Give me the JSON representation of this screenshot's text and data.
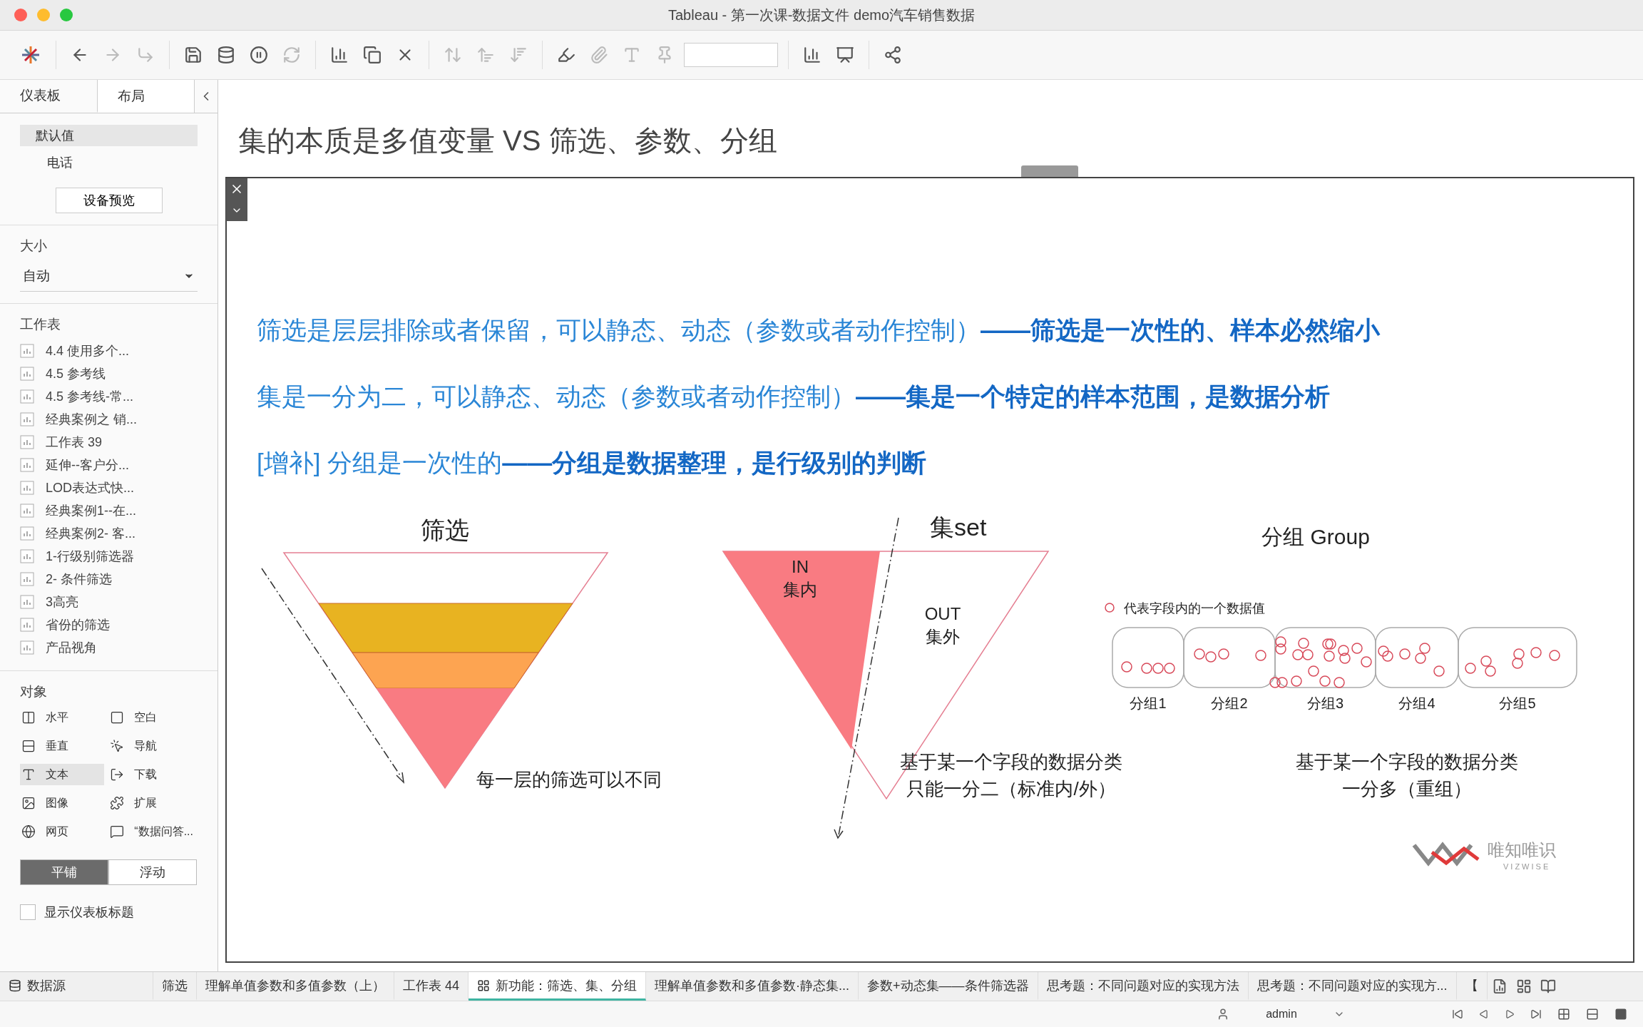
{
  "window": {
    "title": "Tableau - 第一次课-数据文件 demo汽车销售数据"
  },
  "sidebar": {
    "tabs": [
      {
        "label": "仪表板",
        "selected": true
      },
      {
        "label": "布局",
        "selected": false
      }
    ],
    "devices": [
      {
        "label": "默认值",
        "selected": true
      },
      {
        "label": "电话",
        "selected": false
      }
    ],
    "device_preview_button": "设备预览",
    "size": {
      "heading": "大小",
      "value": "自动"
    },
    "sheets": {
      "heading": "工作表",
      "items": [
        "4.4 使用多个...",
        "4.5 参考线",
        "4.5 参考线-常...",
        "经典案例之 销...",
        "工作表 39",
        "延伸--客户分...",
        "LOD表达式快...",
        "经典案例1--在...",
        "经典案例2- 客...",
        "1-行级别筛选器",
        "2- 条件筛选",
        "3高亮",
        "省份的筛选",
        "产品视角"
      ]
    },
    "objects": {
      "heading": "对象",
      "items": [
        {
          "label": "水平",
          "selected": false
        },
        {
          "label": "空白",
          "selected": false
        },
        {
          "label": "垂直",
          "selected": false
        },
        {
          "label": "导航",
          "selected": false
        },
        {
          "label": "文本",
          "selected": true
        },
        {
          "label": "下载",
          "selected": false
        },
        {
          "label": "图像",
          "selected": false
        },
        {
          "label": "扩展",
          "selected": false
        },
        {
          "label": "网页",
          "selected": false
        },
        {
          "label": "“数据问答...",
          "selected": false
        }
      ]
    },
    "layout_mode": [
      {
        "label": "平铺",
        "selected": true
      },
      {
        "label": "浮动",
        "selected": false
      }
    ],
    "show_title": {
      "label": "显示仪表板标题",
      "checked": false
    }
  },
  "dashboard": {
    "title": "集的本质是多值变量 VS 筛选、参数、分组",
    "slide": {
      "lines": [
        "筛选是层层排除或者保留，可以静态、动态（参数或者动作控制）**——筛选是一次性的、样本必然缩小**",
        "集是一分为二，可以静态、动态（参数或者动作控制）**——集是一个特定的样本范围，是数据分析**",
        "[增补] 分组是一次性的**——分组是数据整理，是行级别的判断**"
      ],
      "filter_diagram": {
        "title": "筛选",
        "note": "每一层的筛选可以不同"
      },
      "set_diagram": {
        "title": "集set",
        "in_label": [
          "IN",
          "集内"
        ],
        "out_label": [
          "OUT",
          "集外"
        ],
        "notes": [
          "基于某一个字段的数据分类",
          "只能一分二（标准内/外）"
        ]
      },
      "group_diagram": {
        "title": "分组 Group",
        "legend": "代表字段内的一个数据值",
        "groups": [
          "分组1",
          "分组2",
          "分组3",
          "分组4",
          "分组5"
        ],
        "notes": [
          "基于某一个字段的数据分类",
          "一分多（重组）"
        ]
      },
      "logo": {
        "name": "唯知唯识",
        "sub": "VIZWISE"
      }
    }
  },
  "sheet_tabs": [
    {
      "label": "数据源",
      "kind": "datasource",
      "selected": false
    },
    {
      "label": "筛选",
      "kind": "sheet",
      "selected": false
    },
    {
      "label": "理解单值参数和多值参数（上）",
      "kind": "sheet",
      "selected": false
    },
    {
      "label": "工作表 44",
      "kind": "sheet",
      "selected": false
    },
    {
      "label": "新功能：筛选、集、分组",
      "kind": "dashboard",
      "selected": true
    },
    {
      "label": "理解单值参数和多值参数·静态集...",
      "kind": "sheet",
      "selected": false
    },
    {
      "label": "参数+动态集——条件筛选器",
      "kind": "sheet",
      "selected": false
    },
    {
      "label": "思考题：不同问题对应的实现方法",
      "kind": "sheet",
      "selected": false
    },
    {
      "label": "思考题：不同问题对应的实现方...",
      "kind": "sheet",
      "selected": false
    },
    {
      "label": "【",
      "kind": "sheet",
      "selected": false
    }
  ],
  "status_bar": {
    "user": "admin"
  }
}
